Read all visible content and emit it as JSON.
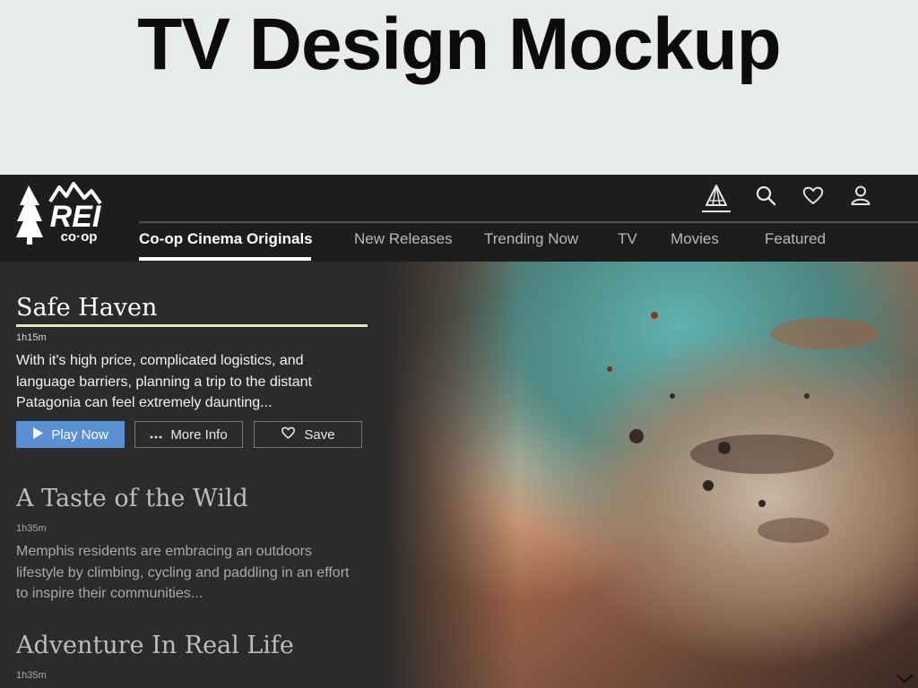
{
  "slide": {
    "title": "TV Design Mockup"
  },
  "brand": {
    "logo_text": "REI",
    "logo_subtext": "co·op"
  },
  "nav": {
    "tabs": [
      {
        "label": "Co-op Cinema Originals",
        "active": true
      },
      {
        "label": "New Releases",
        "active": false
      },
      {
        "label": "Trending Now",
        "active": false
      },
      {
        "label": "TV",
        "active": false
      },
      {
        "label": "Movies",
        "active": false
      },
      {
        "label": "Featured",
        "active": false
      }
    ],
    "utility_icons": [
      "tent-icon",
      "search-icon",
      "heart-icon",
      "user-icon"
    ]
  },
  "items": [
    {
      "title": "Safe Haven",
      "duration": "1h15m",
      "description": "With it's high price, complicated logistics, and language barriers, planning a trip to the distant Patagonia can feel extremely daunting...",
      "selected": true
    },
    {
      "title": "A Taste of the Wild",
      "duration": "1h35m",
      "description": "Memphis residents are embracing an outdoors lifestyle by climbing, cycling and paddling in an effort to inspire their communities...",
      "selected": false
    },
    {
      "title": "Adventure In Real Life",
      "duration": "1h35m",
      "description": "",
      "selected": false
    }
  ],
  "actions": {
    "play_label": "Play Now",
    "more_info_label": "More Info",
    "save_label": "Save"
  },
  "colors": {
    "accent": "#5a8fd3",
    "topbar": "#1d1d1d",
    "sidebar": "#2b2b2b",
    "title_rule": "#e6e2c4"
  }
}
